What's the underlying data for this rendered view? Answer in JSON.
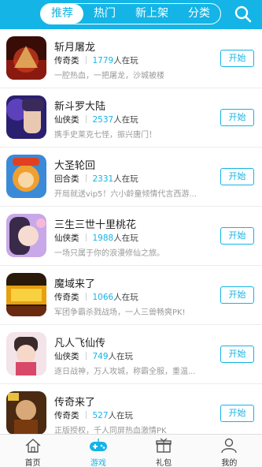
{
  "header": {
    "tabs": [
      {
        "label": "推荐",
        "active": true
      },
      {
        "label": "热门",
        "active": false
      },
      {
        "label": "新上架",
        "active": false
      },
      {
        "label": "分类",
        "active": false
      }
    ],
    "search_icon": "search-icon"
  },
  "games": [
    {
      "title": "斩月屠龙",
      "category": "传奇类",
      "count": "1779",
      "playing": "人在玩",
      "desc": "一腔热血，一把屠龙，沙城被楼",
      "button": "开始"
    },
    {
      "title": "新斗罗大陆",
      "category": "仙侠类",
      "count": "2537",
      "playing": "人在玩",
      "desc": "携手史莱克七怪，振兴唐门！",
      "button": "开始"
    },
    {
      "title": "大圣轮回",
      "category": "回合类",
      "count": "2331",
      "playing": "人在玩",
      "desc": "开局就送vip5！六小龄童倾情代言西游...",
      "button": "开始"
    },
    {
      "title": "三生三世十里桃花",
      "category": "仙侠类",
      "count": "1988",
      "playing": "人在玩",
      "desc": "一场只属于你的浪漫修仙之旅。",
      "button": "开始"
    },
    {
      "title": "魔域来了",
      "category": "传奇类",
      "count": "1066",
      "playing": "人在玩",
      "desc": "军团争霸杀戮战场，一人三兽畅爽PK!",
      "button": "开始"
    },
    {
      "title": "凡人飞仙传",
      "category": "仙侠类",
      "count": "749",
      "playing": "人在玩",
      "desc": "逐日战神，万人攻城，称霸全服，重温...",
      "button": "开始"
    },
    {
      "title": "传奇来了",
      "category": "传奇类",
      "count": "527",
      "playing": "人在玩",
      "desc": "正版授权，千人同屏热血激情PK",
      "button": "开始"
    }
  ],
  "bottom_nav": [
    {
      "label": "首页",
      "icon": "home-icon",
      "active": false
    },
    {
      "label": "游戏",
      "icon": "gamepad-icon",
      "active": true
    },
    {
      "label": "礼包",
      "icon": "gift-icon",
      "active": false
    },
    {
      "label": "我的",
      "icon": "user-icon",
      "active": false
    }
  ],
  "colors": {
    "accent": "#14b4e6",
    "text": "#222222",
    "muted": "#999999"
  }
}
